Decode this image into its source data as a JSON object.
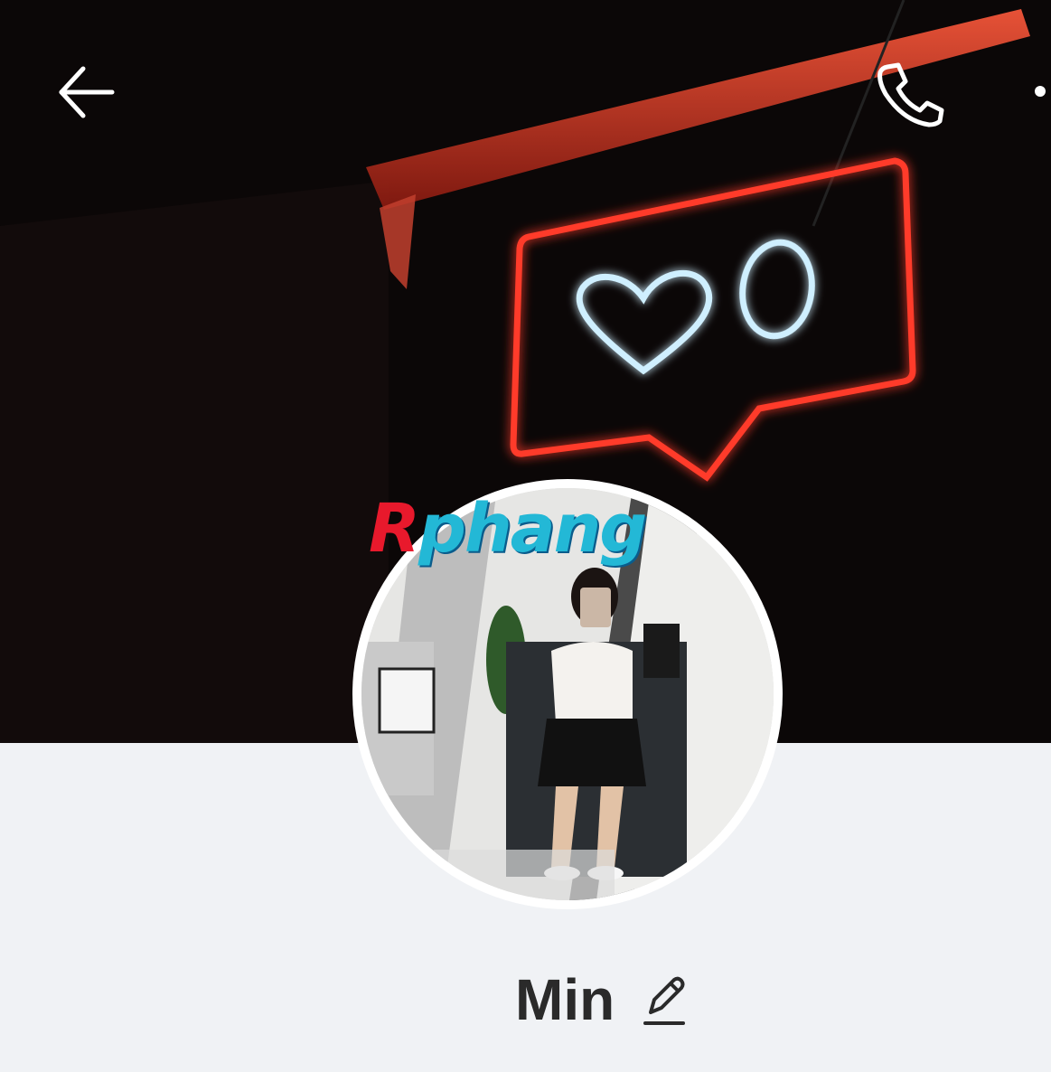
{
  "header": {
    "back_icon": "arrow-left-icon",
    "call_icon": "phone-icon",
    "more_icon": "more-dots-icon"
  },
  "cover": {
    "neon_text": "0",
    "neon_icon": "heart-icon"
  },
  "watermark": {
    "part1": "R",
    "part2": "phang"
  },
  "profile": {
    "name": "Min",
    "edit_icon": "pencil-icon"
  },
  "colors": {
    "background": "#f0f2f5",
    "neon_red": "#ff3a2a",
    "neon_blue": "#cfefff",
    "name_text": "#2a2a2a"
  }
}
